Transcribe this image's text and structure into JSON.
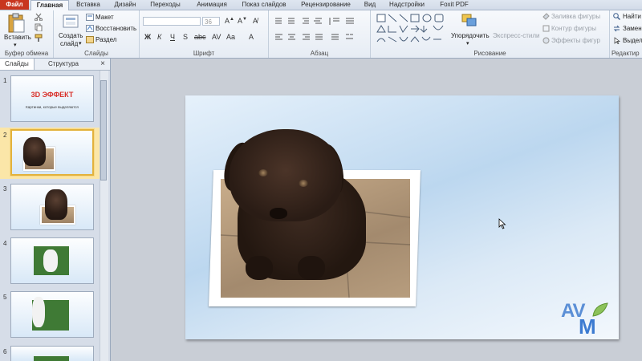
{
  "tabs": [
    "Файл",
    "Главная",
    "Вставка",
    "Дизайн",
    "Переходы",
    "Анимация",
    "Показ слайдов",
    "Рецензирование",
    "Вид",
    "Надстройки",
    "Foxit PDF"
  ],
  "clipboard": {
    "paste": "Вставить",
    "label": "Буфер обмена"
  },
  "slides_group": {
    "create_line1": "Создать",
    "create_line2": "слайд",
    "layout": "Макет",
    "restore": "Восстановить",
    "section": "Раздел",
    "label": "Слайды"
  },
  "font_group": {
    "font_size": "36",
    "label": "Шрифт"
  },
  "paragraph_group": {
    "label": "Абзац"
  },
  "drawing_group": {
    "arrange": "Упорядочить",
    "quick_styles": "Экспресс-стили",
    "fill": "Заливка фигуры",
    "outline": "Контур фигуры",
    "effects": "Эффекты фигур",
    "label": "Рисование"
  },
  "editing_group": {
    "find": "Найти",
    "replace": "Замен",
    "select": "Выдел",
    "label": "Редактир"
  },
  "pane": {
    "tab_slides": "Слайды",
    "tab_outline": "Структура",
    "close": "×"
  },
  "slide_numbers": [
    "1",
    "2",
    "3",
    "4",
    "5",
    "6"
  ],
  "thumb1": {
    "title": "3D ЭФФЕКТ",
    "subtitle": "Картинки, которые выделяются"
  },
  "logo": {
    "line1": "AV",
    "line2": "M"
  }
}
